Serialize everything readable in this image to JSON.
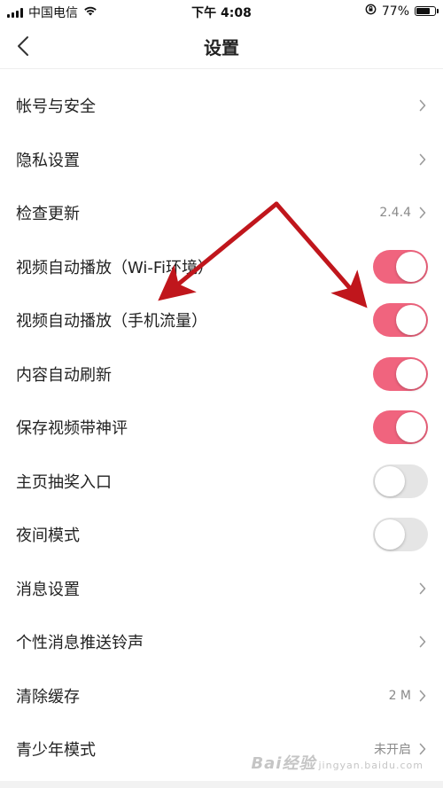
{
  "status_bar": {
    "carrier": "中国电信",
    "time": "下午 4:08",
    "battery": "77%",
    "battery_level": 0.77
  },
  "header": {
    "title": "设置"
  },
  "settings": [
    {
      "label": "帐号与安全",
      "control": "chevron",
      "value": ""
    },
    {
      "label": "隐私设置",
      "control": "chevron",
      "value": ""
    },
    {
      "label": "检查更新",
      "control": "chevron",
      "value": "2.4.4"
    },
    {
      "label": "视频自动播放（Wi-Fi环境）",
      "control": "toggle",
      "on": true
    },
    {
      "label": "视频自动播放（手机流量）",
      "control": "toggle",
      "on": true
    },
    {
      "label": "内容自动刷新",
      "control": "toggle",
      "on": true
    },
    {
      "label": "保存视频带神评",
      "control": "toggle",
      "on": true
    },
    {
      "label": "主页抽奖入口",
      "control": "toggle",
      "on": false
    },
    {
      "label": "夜间模式",
      "control": "toggle",
      "on": false
    },
    {
      "label": "消息设置",
      "control": "chevron",
      "value": ""
    },
    {
      "label": "个性消息推送铃声",
      "control": "chevron",
      "value": ""
    },
    {
      "label": "清除缓存",
      "control": "chevron",
      "value": "2 M"
    },
    {
      "label": "青少年模式",
      "control": "chevron",
      "value": "未开启"
    }
  ],
  "watermark": {
    "text": "Bai经验",
    "sub": "jingyan.baidu.com"
  },
  "colors": {
    "toggle_on": "#f0647e",
    "toggle_off": "#e5e5e5",
    "annotation_arrow": "#c0161c"
  }
}
